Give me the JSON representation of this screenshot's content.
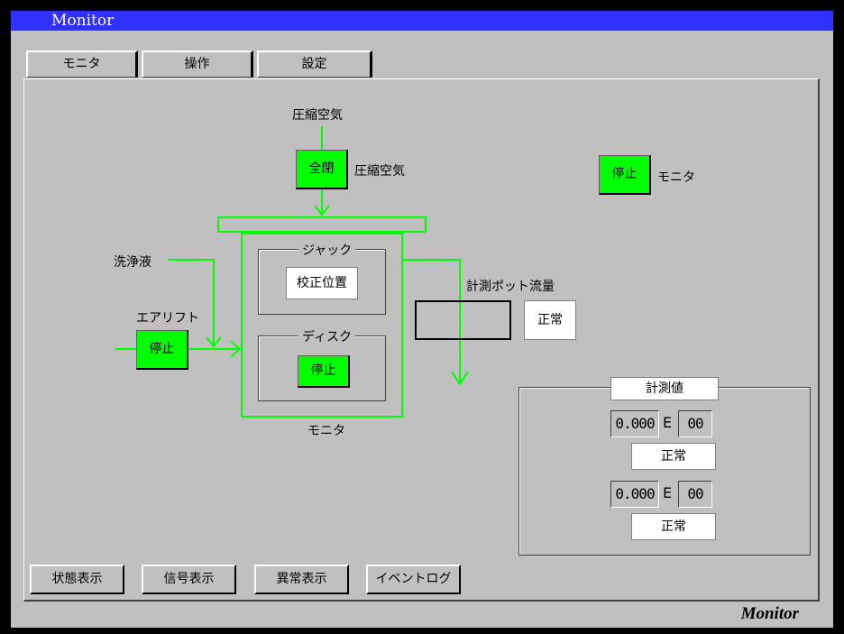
{
  "window": {
    "title": "Monitor",
    "footer_brand": "Monitor"
  },
  "tabs": [
    "モニタ",
    "操作",
    "設定"
  ],
  "diagram": {
    "air_top_label": "圧縮空気",
    "valve_state": "全閉",
    "valve_label": "圧縮空気",
    "wash_label": "洗浄液",
    "airlift_label": "エアリフト",
    "airlift_state": "停止",
    "jack_title": "ジャック",
    "jack_state": "校正位置",
    "disk_title": "ディスク",
    "disk_state": "停止",
    "unit_label": "モニタ",
    "pot_label": "計測ポット流量",
    "pot_status": "正常",
    "monitor_state": "停止",
    "monitor_label": "モニタ"
  },
  "measurement": {
    "title": "計測値",
    "rows": [
      {
        "mantissa": "0.000",
        "e": "E",
        "exponent": "00",
        "status": "正常"
      },
      {
        "mantissa": "0.000",
        "e": "E",
        "exponent": "00",
        "status": "正常"
      }
    ]
  },
  "buttons": [
    "状態表示",
    "信号表示",
    "異常表示",
    "イベントログ"
  ],
  "colors": {
    "title_bar": "#3030ff",
    "active_green": "#00ff00",
    "background": "#c0c0c0"
  }
}
